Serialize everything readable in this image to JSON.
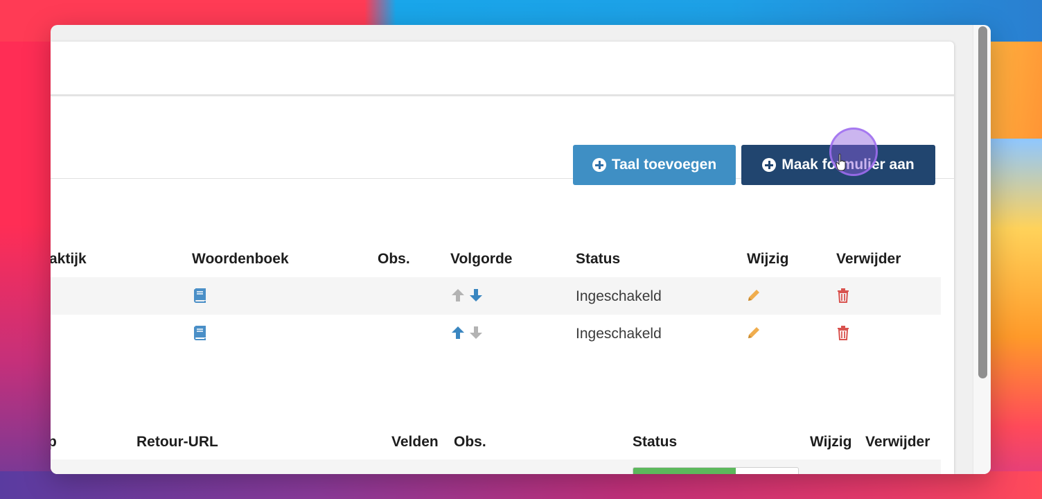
{
  "toolbar": {
    "add_language_label": "Taal toevoegen",
    "create_form_label": "Maak formulier aan"
  },
  "table1": {
    "headers": {
      "practice": "aktijk",
      "dictionary": "Woordenboek",
      "obs": "Obs.",
      "order": "Volgorde",
      "status": "Status",
      "edit": "Wijzig",
      "delete": "Verwijder"
    },
    "rows": [
      {
        "status": "Ingeschakeld",
        "up_enabled": false,
        "down_enabled": true
      },
      {
        "status": "Ingeschakeld",
        "up_enabled": true,
        "down_enabled": false
      }
    ]
  },
  "table2": {
    "headers": {
      "partial": "p",
      "return_url": "Retour-URL",
      "fields": "Velden",
      "obs": "Obs.",
      "status": "Status",
      "edit": "Wijzig",
      "delete": "Verwijder"
    }
  },
  "colors": {
    "btn_primary_light": "#3f8fc4",
    "btn_primary_dark": "#21456f",
    "arrow_active": "#3a86c0",
    "arrow_disabled": "#b3b3b3",
    "pencil": "#f0ad4e",
    "trash": "#d9534f",
    "dictionary_icon": "#4a8fc7"
  },
  "icons": {
    "dictionary": "book-icon",
    "edit": "pencil-icon",
    "delete": "trash-icon",
    "add": "plus-circle-icon"
  }
}
